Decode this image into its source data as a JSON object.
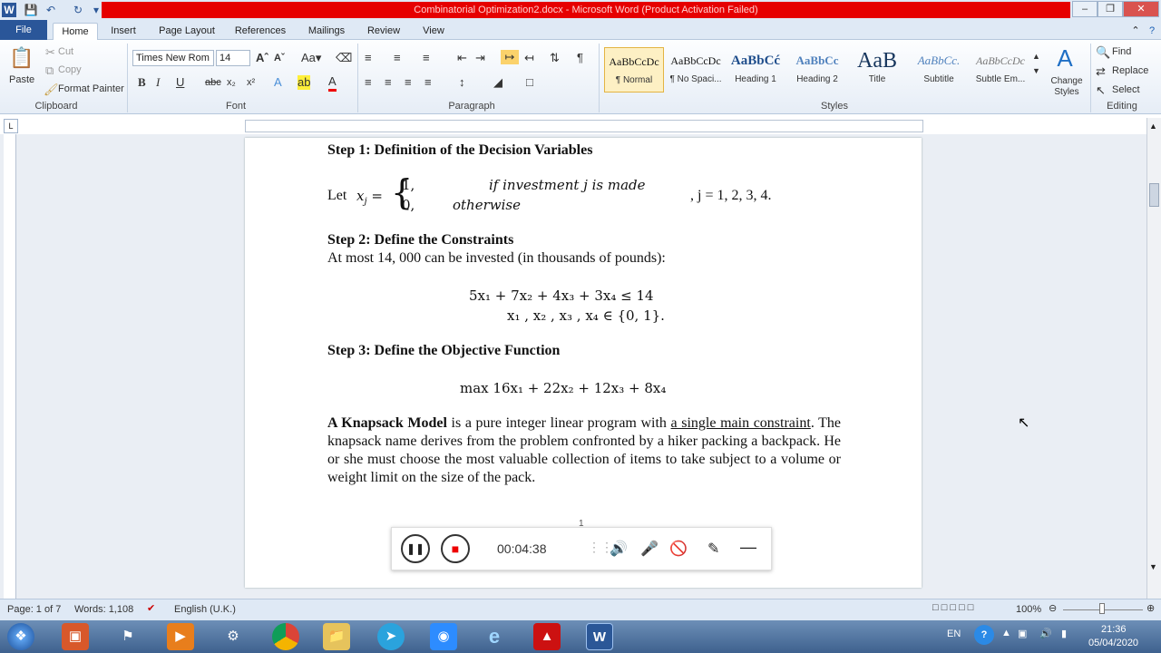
{
  "window": {
    "title": "Combinatorial Optimization2.docx - Microsoft Word (Product Activation Failed)"
  },
  "tabs": [
    "File",
    "Home",
    "Insert",
    "Page Layout",
    "References",
    "Mailings",
    "Review",
    "View"
  ],
  "clipboard": {
    "paste": "Paste",
    "cut": "Cut",
    "copy": "Copy",
    "format_painter": "Format Painter",
    "label": "Clipboard"
  },
  "font": {
    "family": "Times New Rom",
    "size": "14",
    "label": "Font"
  },
  "paragraph": {
    "label": "Paragraph"
  },
  "styles": {
    "label": "Styles",
    "items": [
      {
        "preview": "AaBbCcDc",
        "name": "¶ Normal"
      },
      {
        "preview": "AaBbCcDc",
        "name": "¶ No Spaci..."
      },
      {
        "preview": "AaBbCć",
        "name": "Heading 1"
      },
      {
        "preview": "AaBbCc",
        "name": "Heading 2"
      },
      {
        "preview": "AaB",
        "name": "Title"
      },
      {
        "preview": "AaBbCc.",
        "name": "Subtitle"
      },
      {
        "preview": "AaBbCcDc",
        "name": "Subtle Em..."
      }
    ],
    "change": "Change Styles"
  },
  "editing": {
    "find": "Find",
    "replace": "Replace",
    "select": "Select",
    "label": "Editing"
  },
  "document": {
    "step1": "Step 1: Definition of the Decision Variables",
    "let": "Let",
    "xj": "x",
    "xj_sub": "j",
    "case1_val": "1,",
    "case1_cond": "if investment   j  is made",
    "case2_val": "0,",
    "case2_cond": "otherwise",
    "j_range": ", j = 1, 2, 3, 4.",
    "step2": "Step 2: Define the Constraints",
    "at_most": "At most 14, 000 can be invested (in thousands of pounds):",
    "constraint": "5x₁  +  7x₂  +  4x₃   +  3x₄    ≤  14",
    "binary": "x₁ , x₂ , x₃ , x₄   ∈ {0, 1}.",
    "step3": "Step 3: Define the Objective Function",
    "objective": "max   16x₁  +  22x₂  +  12x₃   +  8x₄",
    "knap_bold": "A Knapsack Model",
    "knap_text1": " is a pure integer linear program with ",
    "knap_underline": "a single main constraint",
    "knap_text2": ". The knapsack name derives from the problem confronted by a hiker packing a backpack. He or she must choose the most valuable collection of items to take subject to a volume or weight limit on the size of the pack.",
    "page_number": "1"
  },
  "recorder": {
    "time": "00:04:38"
  },
  "status": {
    "page": "Page: 1 of 7",
    "words": "Words: 1,108",
    "language": "English (U.K.)",
    "zoom": "100%"
  },
  "taskbar": {
    "lang": "EN",
    "time": "21:36",
    "date": "05/04/2020"
  }
}
